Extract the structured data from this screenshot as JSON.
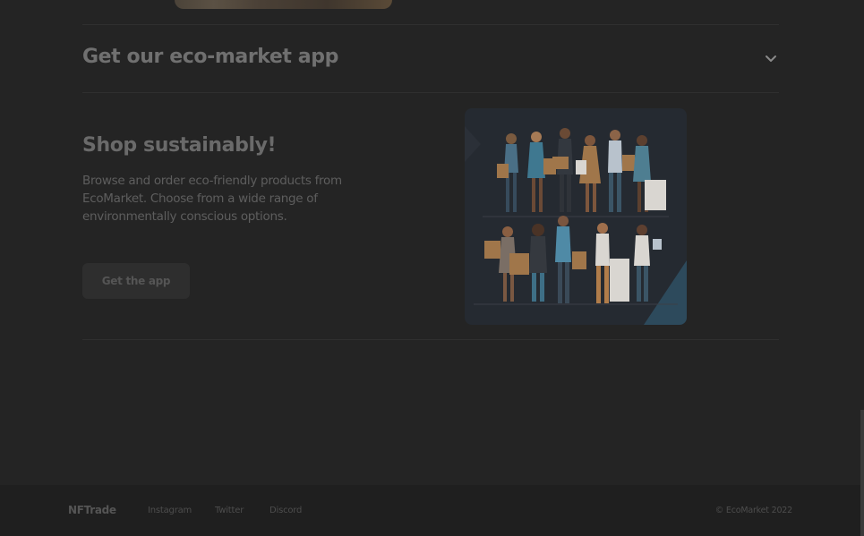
{
  "accordion": {
    "title": "Get our eco-market app",
    "icon": "chevron-down-icon"
  },
  "promo": {
    "title": "Shop sustainably!",
    "description": "Browse and order eco-friendly products from EcoMarket. Choose from a wide range of environmentally conscious options.",
    "cta_label": "Get the app"
  },
  "footer": {
    "brand": "NFTrade",
    "links": [
      "Instagram",
      "Twitter",
      "Discord"
    ],
    "copyright": "© EcoMarket 2022"
  },
  "colors": {
    "background": "#242424",
    "footer_background": "#1f1f1f",
    "illustration_bg": "#252a31",
    "shopping_bag": "#a0764a"
  }
}
